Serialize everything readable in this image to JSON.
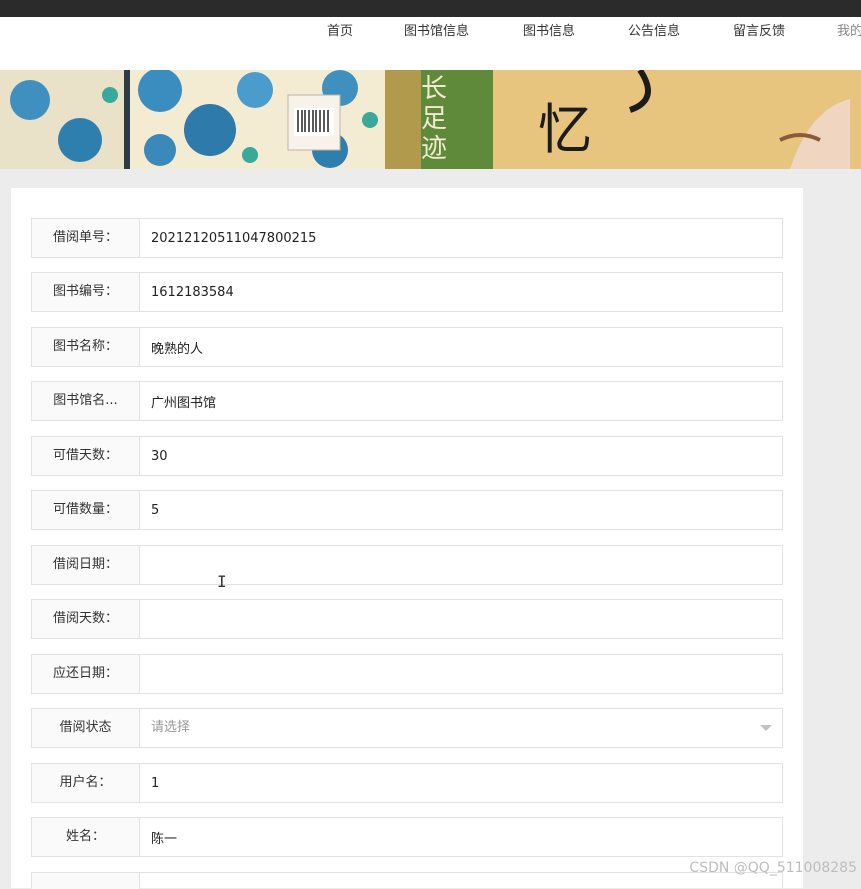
{
  "nav": {
    "items": [
      "首页",
      "图书馆信息",
      "图书信息",
      "公告信息",
      "留言反馈",
      "我的"
    ]
  },
  "banner": {
    "left_text": "长足迹",
    "right_text": "忆"
  },
  "form": {
    "fields": [
      {
        "label": "借阅单号：",
        "value": "20212120511047800215"
      },
      {
        "label": "图书编号：",
        "value": "1612183584"
      },
      {
        "label": "图书名称：",
        "value": "晚熟的人"
      },
      {
        "label": "图书馆名...",
        "value": "广州图书馆"
      },
      {
        "label": "可借天数：",
        "value": "30"
      },
      {
        "label": "可借数量：",
        "value": "5"
      },
      {
        "label": "借阅日期：",
        "value": ""
      },
      {
        "label": "借阅天数：",
        "value": ""
      },
      {
        "label": "应还日期：",
        "value": ""
      },
      {
        "label": "借阅状态",
        "placeholder": "请选择"
      },
      {
        "label": "用户名：",
        "value": "1"
      },
      {
        "label": "姓名：",
        "value": "陈一"
      }
    ]
  },
  "watermark": "CSDN @QQ_511008285",
  "colors": {
    "topbar": "#2b2b2b",
    "page_bg": "#ececec",
    "border": "#e2e2e2"
  }
}
